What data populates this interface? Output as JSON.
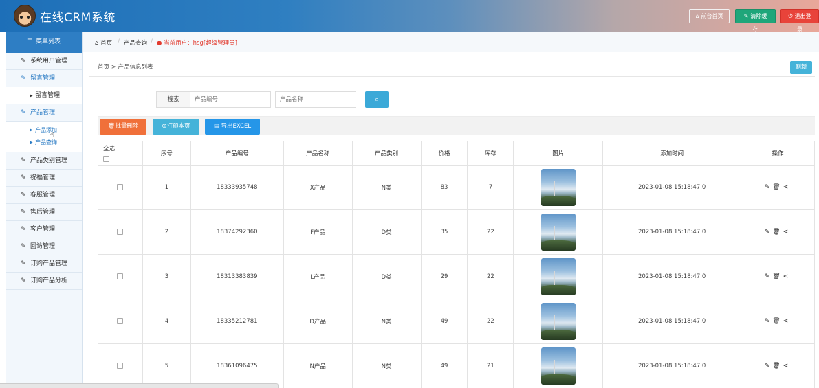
{
  "header": {
    "title": "在线CRM系统",
    "front_label": "前台首页",
    "clear_label": "清除缓存",
    "logout_label": "退出登录"
  },
  "sidebar": {
    "head": "菜单列表",
    "items": [
      {
        "label": "系统用户管理"
      },
      {
        "label": "留言管理"
      },
      {
        "label": "留言管理"
      },
      {
        "label": "产品管理"
      },
      {
        "label": "产品添加"
      },
      {
        "label": "产品查询"
      },
      {
        "label": "产品类别管理"
      },
      {
        "label": "祝福管理"
      },
      {
        "label": "客服管理"
      },
      {
        "label": "售后管理"
      },
      {
        "label": "客户管理"
      },
      {
        "label": "回访管理"
      },
      {
        "label": "订购产品管理"
      },
      {
        "label": "订购产品分析"
      }
    ]
  },
  "topcrumb": {
    "home": "首页",
    "query": "产品查询",
    "user": "当前用户：hsg[超级管理员]"
  },
  "panel": {
    "crumb": "首页 > 产品信息列表",
    "refresh": "刷新",
    "search_label": "搜索",
    "search_placeholder_code": "产品编号",
    "search_placeholder_name": "产品名称",
    "btn_delete": "批量删除",
    "btn_print": "打印本页",
    "btn_excel": "导出EXCEL"
  },
  "table": {
    "headers": [
      "全选",
      "序号",
      "产品编号",
      "产品名称",
      "产品类别",
      "价格",
      "库存",
      "图片",
      "添加时间",
      "操作"
    ],
    "rows": [
      {
        "idx": "1",
        "code": "18333935748",
        "name": "X产品",
        "cat": "N类",
        "price": "83",
        "stock": "7",
        "time": "2023-01-08 15:18:47.0"
      },
      {
        "idx": "2",
        "code": "18374292360",
        "name": "F产品",
        "cat": "D类",
        "price": "35",
        "stock": "22",
        "time": "2023-01-08 15:18:47.0"
      },
      {
        "idx": "3",
        "code": "18313383839",
        "name": "L产品",
        "cat": "D类",
        "price": "29",
        "stock": "22",
        "time": "2023-01-08 15:18:47.0"
      },
      {
        "idx": "4",
        "code": "18335212781",
        "name": "D产品",
        "cat": "N类",
        "price": "49",
        "stock": "22",
        "time": "2023-01-08 15:18:47.0"
      },
      {
        "idx": "5",
        "code": "18361096475",
        "name": "N产品",
        "cat": "N类",
        "price": "49",
        "stock": "21",
        "time": "2023-01-08 15:18:47.0"
      }
    ]
  },
  "icons": {
    "home": "home-icon",
    "user": "user-icon",
    "edit": "edit-icon",
    "delete": "trash-icon",
    "share": "share-icon",
    "search": "search-icon"
  },
  "colors": {
    "accent": "#2e7ec4",
    "danger": "#e8433a",
    "success": "#1fa67a",
    "orange": "#f0703a"
  }
}
